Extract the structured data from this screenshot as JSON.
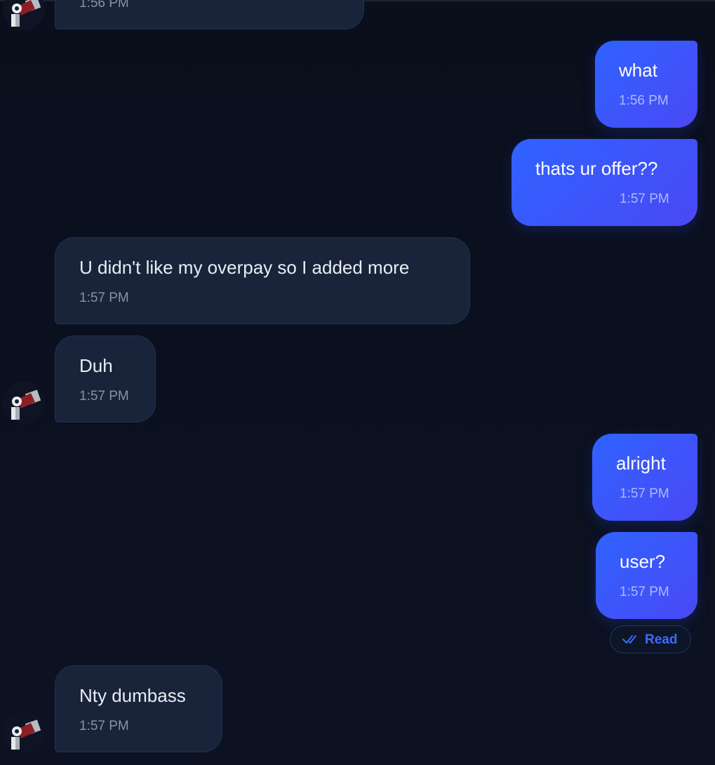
{
  "messages": [
    {
      "side": "in",
      "text": "",
      "time": "1:56 PM"
    },
    {
      "side": "out",
      "text": "what",
      "time": "1:56 PM"
    },
    {
      "side": "out",
      "text": "thats ur offer??",
      "time": "1:57 PM"
    },
    {
      "side": "in",
      "text": "U didn't like my overpay so I added more",
      "time": "1:57 PM"
    },
    {
      "side": "in",
      "text": "Duh",
      "time": "1:57 PM"
    },
    {
      "side": "out",
      "text": "alright",
      "time": "1:57 PM"
    },
    {
      "side": "out",
      "text": "user?",
      "time": "1:57 PM"
    },
    {
      "side": "in",
      "text": "Nty dumbass",
      "time": "1:57 PM"
    }
  ],
  "read_receipt": {
    "label": "Read",
    "icon": "double-check-icon"
  },
  "colors": {
    "background": "#0b1120",
    "incoming_bubble": "#19243a",
    "outgoing_bubble_start": "#2f63ff",
    "outgoing_bubble_end": "#4a48f5",
    "read_accent": "#3b6dff"
  }
}
